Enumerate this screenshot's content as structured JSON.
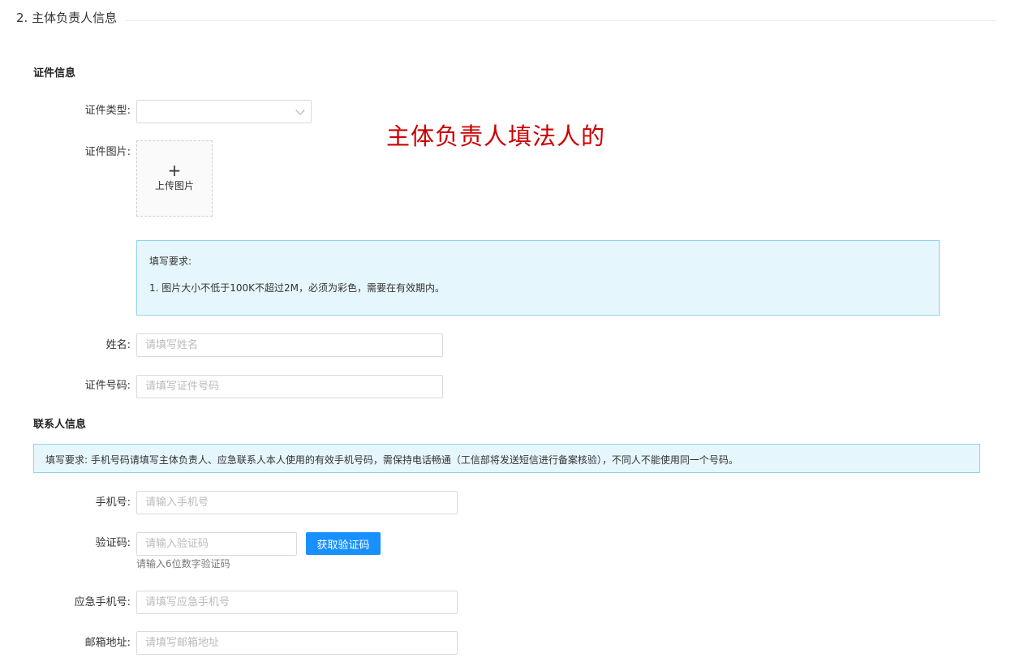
{
  "section": {
    "title": "2. 主体负责人信息"
  },
  "cert": {
    "subtitle": "证件信息",
    "type_label": "证件类型:",
    "type_value": "",
    "image_label": "证件图片:",
    "upload_plus": "+",
    "upload_label": "上传图片",
    "annotation": "主体负责人填法人的",
    "notice_title": "填写要求:",
    "notice_line1": "1. 图片大小不低于100K不超过2M，必须为彩色，需要在有效期内。",
    "name_label": "姓名:",
    "name_placeholder": "请填写姓名",
    "number_label": "证件号码:",
    "number_placeholder": "请填写证件号码"
  },
  "contact": {
    "subtitle": "联系人信息",
    "notice": "填写要求: 手机号码请填写主体负责人、应急联系人本人使用的有效手机号码，需保持电话畅通（工信部将发送短信进行备案核验），不同人不能使用同一个号码。",
    "phone_label": "手机号:",
    "phone_placeholder": "请输入手机号",
    "code_label": "验证码:",
    "code_placeholder": "请输入验证码",
    "code_button": "获取验证码",
    "code_hint": "请输入6位数字验证码",
    "emergency_label": "应急手机号:",
    "emergency_placeholder": "请填写应急手机号",
    "email_label": "邮箱地址:",
    "email_placeholder": "请填写邮箱地址"
  },
  "colors": {
    "primary": "#1890ff",
    "notice_bg": "#e6f6fd",
    "notice_border": "#8fd3ec",
    "annotation": "#cc0000"
  }
}
